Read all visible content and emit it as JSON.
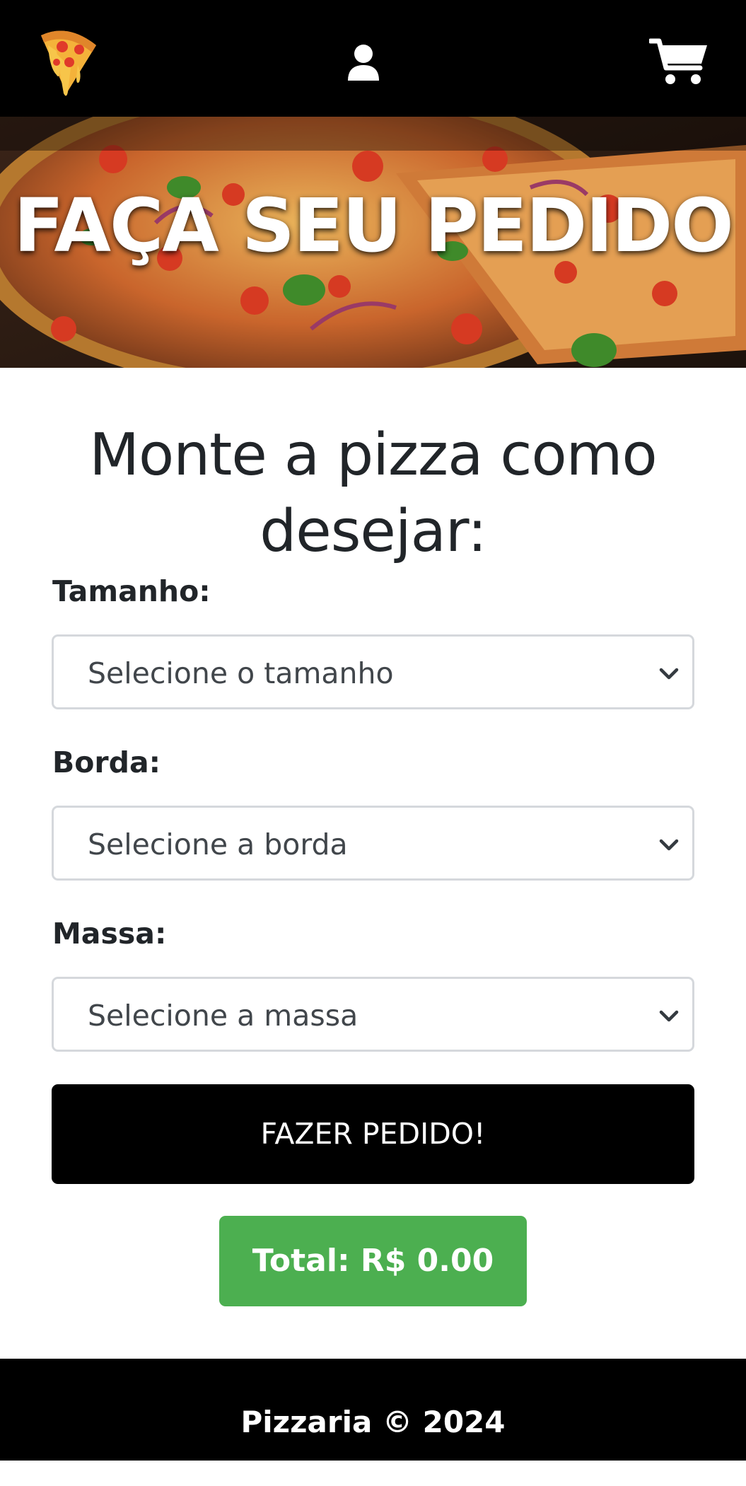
{
  "header": {
    "logo_icon": "pizza-slice-icon",
    "user_icon": "user-icon",
    "cart_icon": "shopping-cart-icon"
  },
  "hero": {
    "title": "FAÇA SEU PEDIDO"
  },
  "form": {
    "heading": "Monte a pizza como desejar:",
    "size": {
      "label": "Tamanho:",
      "value": "Selecione o tamanho"
    },
    "crust": {
      "label": "Borda:",
      "value": "Selecione a borda"
    },
    "dough": {
      "label": "Massa:",
      "value": "Selecione a massa"
    },
    "submit_label": "FAZER PEDIDO!",
    "total": "Total: R$ 0.00"
  },
  "footer": {
    "text": "Pizzaria © 2024"
  },
  "colors": {
    "header_bg": "#000000",
    "button_bg": "#000000",
    "total_bg": "#4caf50",
    "footer_bg": "#000000"
  }
}
